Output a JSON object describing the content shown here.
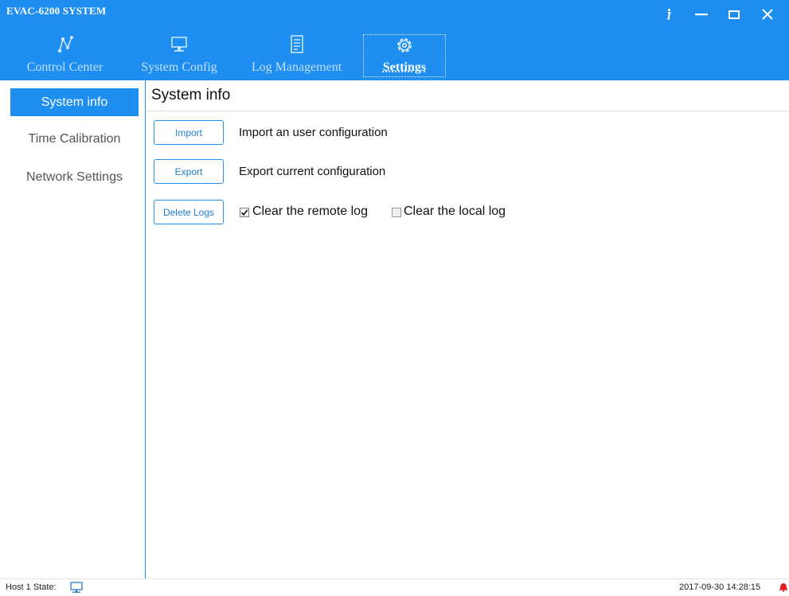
{
  "app": {
    "title": "EVAC-6200 SYSTEM",
    "header_color": "#1e8ff0"
  },
  "window_controls": {
    "info_icon": "info-icon",
    "minimize_icon": "minimize-icon",
    "maximize_icon": "maximize-icon",
    "close_icon": "close-icon"
  },
  "nav": {
    "tabs": [
      {
        "label": "Control Center",
        "icon": "graph-nodes-icon",
        "active": false
      },
      {
        "label": "System Config",
        "icon": "monitor-icon",
        "active": false
      },
      {
        "label": "Log Management",
        "icon": "document-icon",
        "active": false
      },
      {
        "label": "Settings",
        "icon": "gear-icon",
        "active": true
      }
    ]
  },
  "sidebar": {
    "items": [
      {
        "label": "System info",
        "active": true
      },
      {
        "label": "Time Calibration",
        "active": false
      },
      {
        "label": "Network Settings",
        "active": false
      }
    ]
  },
  "main": {
    "title": "System info",
    "import": {
      "button_label": "Import",
      "description": "Import an user configuration"
    },
    "export": {
      "button_label": "Export",
      "description": "Export current configuration"
    },
    "delete_logs": {
      "button_label": "Delete Logs",
      "remote": {
        "label": "Clear the remote log",
        "checked": true
      },
      "local": {
        "label": "Clear the local log",
        "checked": false
      }
    }
  },
  "status": {
    "host_label": "Host 1 State:",
    "host_icon": "computer-icon",
    "datetime": "2017-09-30 14:28:15",
    "alarm_icon": "alarm-bell-icon",
    "alarm_color": "#e02020"
  }
}
